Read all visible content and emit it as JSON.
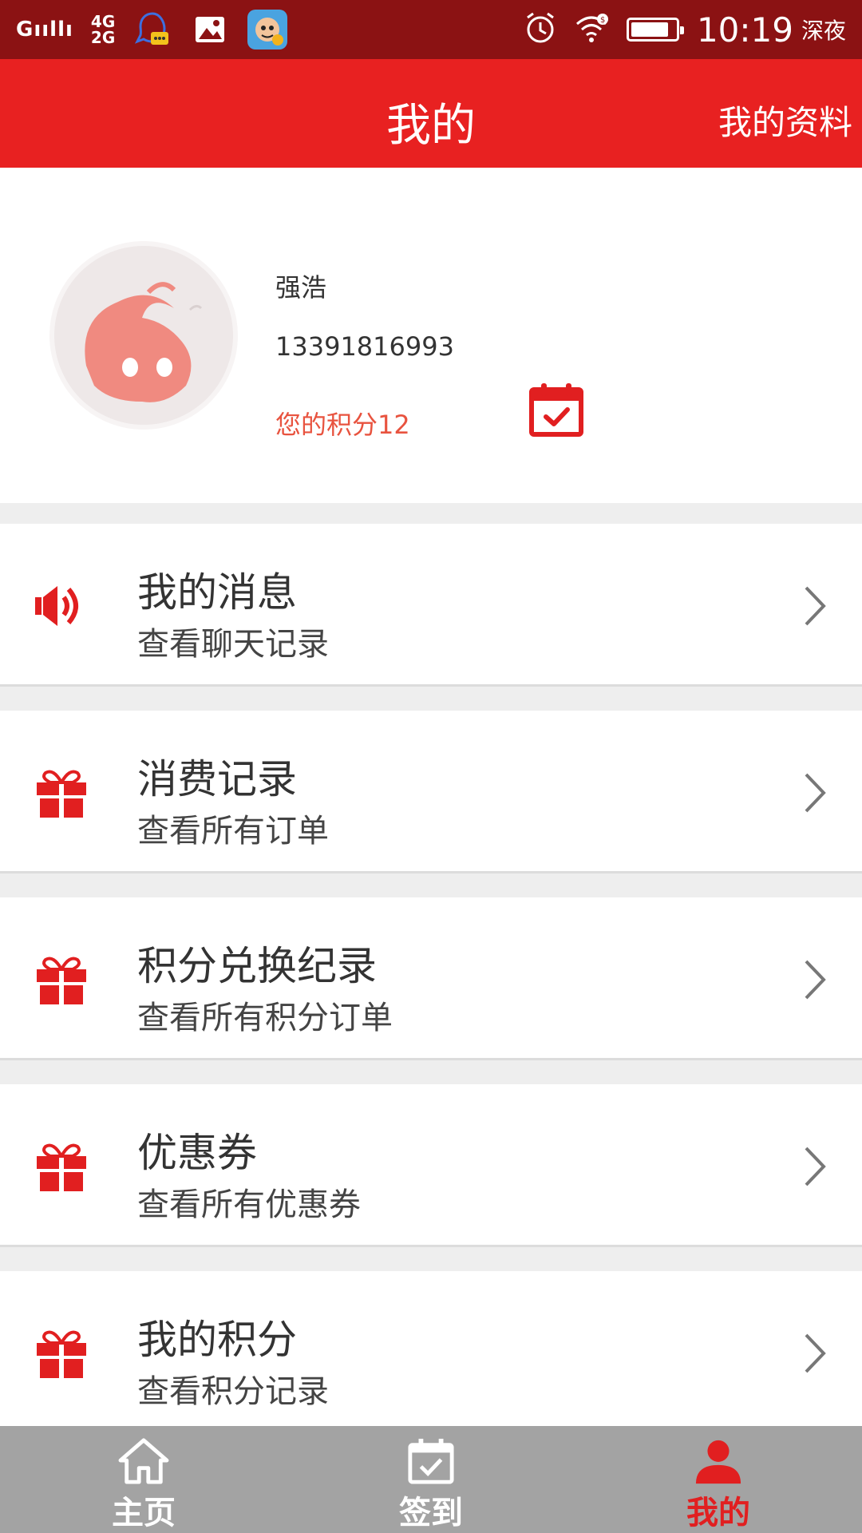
{
  "status_bar": {
    "signal1": "Gııllı",
    "net_4g": "4G",
    "net_2g": "2G",
    "time": "10:19",
    "night_label": "深夜",
    "battery_fraction": 0.85
  },
  "header": {
    "title": "我的",
    "action_label": "我的资料"
  },
  "profile": {
    "name": "强浩",
    "phone": "13391816993",
    "points_text": "您的积分12"
  },
  "menu": [
    {
      "icon": "speaker-icon",
      "title": "我的消息",
      "subtitle": "查看聊天记录"
    },
    {
      "icon": "gift-icon",
      "title": "消费记录",
      "subtitle": "查看所有订单"
    },
    {
      "icon": "gift-icon",
      "title": "积分兑换纪录",
      "subtitle": "查看所有积分订单"
    },
    {
      "icon": "gift-icon",
      "title": "优惠券",
      "subtitle": "查看所有优惠券"
    },
    {
      "icon": "gift-icon",
      "title": "我的积分",
      "subtitle": "查看积分记录"
    }
  ],
  "bottom_nav": [
    {
      "icon": "home-icon",
      "label": "主页"
    },
    {
      "icon": "checkin-icon",
      "label": "签到"
    },
    {
      "icon": "person-icon",
      "label": "我的",
      "active": true
    }
  ],
  "colors": {
    "accent": "#e82121",
    "status_bar": "#8b1213",
    "nav_bg": "#a3a3a3",
    "points_text": "#e8533f"
  }
}
